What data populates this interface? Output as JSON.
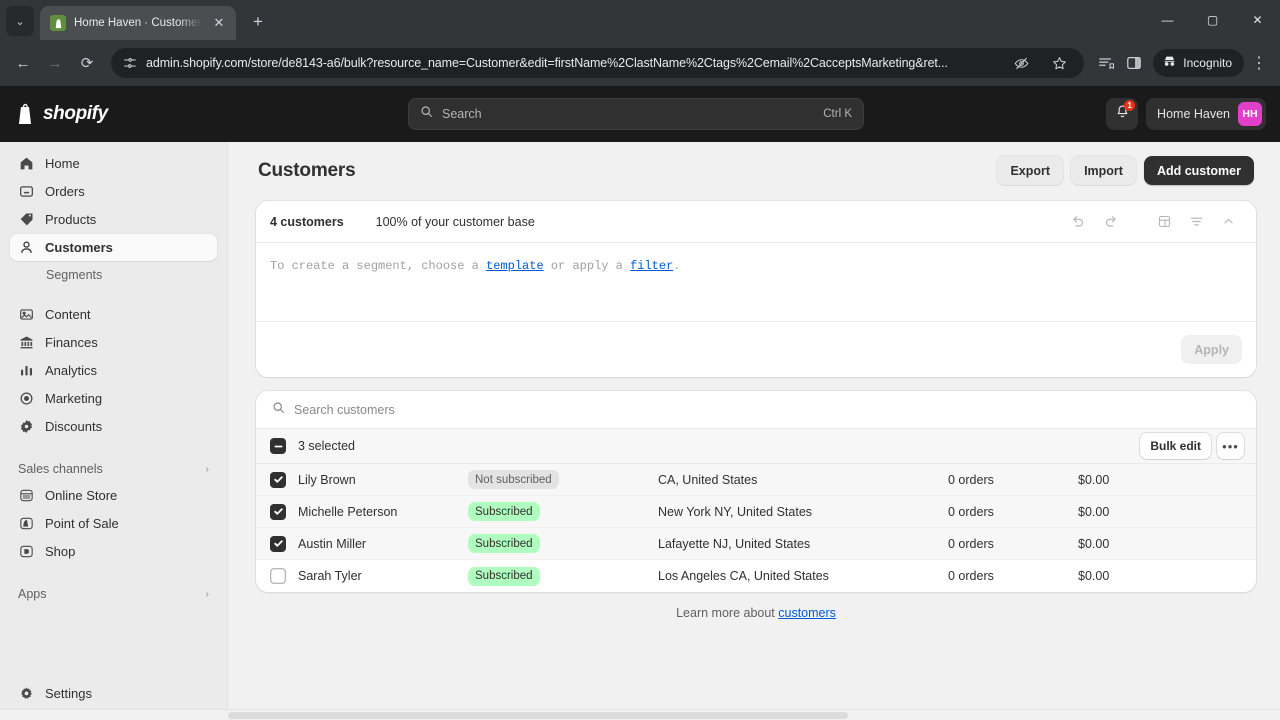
{
  "browser": {
    "tab": {
      "title": "Home Haven · Customers · Sho",
      "favicon": "shopify-bag-icon",
      "close": "✕"
    },
    "new_tab": "+",
    "tab_list_chevron": "⌄",
    "window": {
      "minimize": "—",
      "maximize": "▢",
      "close": "✕"
    },
    "nav": {
      "back": "←",
      "forward": "→",
      "reload": "⟳"
    },
    "url": "admin.shopify.com/store/de8143-a6/bulk?resource_name=Customer&edit=firstName%2ClastName%2Ctags%2Cemail%2CacceptsMarketing&ret...",
    "site_info_icon": "page-settings-icon",
    "icons": {
      "eye_slash": "tracking-protection-icon",
      "bookmark": "star-icon",
      "reading_list": "reading-list-icon",
      "side_panel": "side-panel-icon",
      "menu": "⋮"
    },
    "incognito_label": "Incognito"
  },
  "topbar": {
    "wordmark": "shopify",
    "search": {
      "placeholder": "Search",
      "shortcut": "Ctrl K"
    },
    "notifications": {
      "count": "1"
    },
    "store": {
      "name": "Home Haven",
      "initials": "HH",
      "avatar_color": "#e040c8"
    }
  },
  "sidebar": {
    "items": [
      {
        "label": "Home",
        "icon": "home-icon",
        "active": false
      },
      {
        "label": "Orders",
        "icon": "orders-icon",
        "active": false
      },
      {
        "label": "Products",
        "icon": "products-tag-icon",
        "active": false
      },
      {
        "label": "Customers",
        "icon": "customers-person-icon",
        "active": true
      }
    ],
    "sub_items": [
      {
        "label": "Segments"
      }
    ],
    "items2": [
      {
        "label": "Content",
        "icon": "content-icon"
      },
      {
        "label": "Finances",
        "icon": "finances-bank-icon"
      },
      {
        "label": "Analytics",
        "icon": "analytics-bars-icon"
      },
      {
        "label": "Marketing",
        "icon": "marketing-target-icon"
      },
      {
        "label": "Discounts",
        "icon": "discounts-icon"
      }
    ],
    "sales_channels": {
      "label": "Sales channels",
      "chevron": "›",
      "items": [
        {
          "label": "Online Store",
          "icon": "online-store-icon"
        },
        {
          "label": "Point of Sale",
          "icon": "point-of-sale-icon"
        },
        {
          "label": "Shop",
          "icon": "shop-icon"
        }
      ]
    },
    "apps": {
      "label": "Apps",
      "chevron": "›"
    },
    "settings": {
      "label": "Settings",
      "icon": "gear-icon"
    }
  },
  "page": {
    "title": "Customers",
    "actions": {
      "export": "Export",
      "import": "Import",
      "add_customer": "Add customer"
    }
  },
  "segment_card": {
    "count": "4 customers",
    "percent": "100% of your customer base",
    "tools": {
      "undo": "undo-icon",
      "redo": "redo-icon",
      "save_view": "save-view-icon",
      "filter": "filter-icon",
      "collapse": "chevron-up-icon"
    },
    "hint": {
      "prefix": "To create a segment, choose a ",
      "link1": "template",
      "middle": " or apply a ",
      "link2": "filter",
      "suffix": "."
    },
    "apply_label": "Apply",
    "apply_disabled": true
  },
  "list_card": {
    "search_placeholder": "Search customers",
    "bulk_bar": {
      "selected_label": "3 selected",
      "bulk_edit_label": "Bulk edit",
      "more_label": "•••"
    },
    "rows": [
      {
        "name": "Lily Brown",
        "subscription": "Not subscribed",
        "subscribed": false,
        "location": "CA, United States",
        "orders": "0 orders",
        "amount": "$0.00",
        "selected": true
      },
      {
        "name": "Michelle Peterson",
        "subscription": "Subscribed",
        "subscribed": true,
        "location": "New York NY, United States",
        "orders": "0 orders",
        "amount": "$0.00",
        "selected": true
      },
      {
        "name": "Austin Miller",
        "subscription": "Subscribed",
        "subscribed": true,
        "location": "Lafayette NJ, United States",
        "orders": "0 orders",
        "amount": "$0.00",
        "selected": true
      },
      {
        "name": "Sarah Tyler",
        "subscription": "Subscribed",
        "subscribed": true,
        "location": "Los Angeles CA, United States",
        "orders": "0 orders",
        "amount": "$0.00",
        "selected": false
      }
    ]
  },
  "footer": {
    "learn_prefix": "Learn more about ",
    "learn_link": "customers"
  }
}
